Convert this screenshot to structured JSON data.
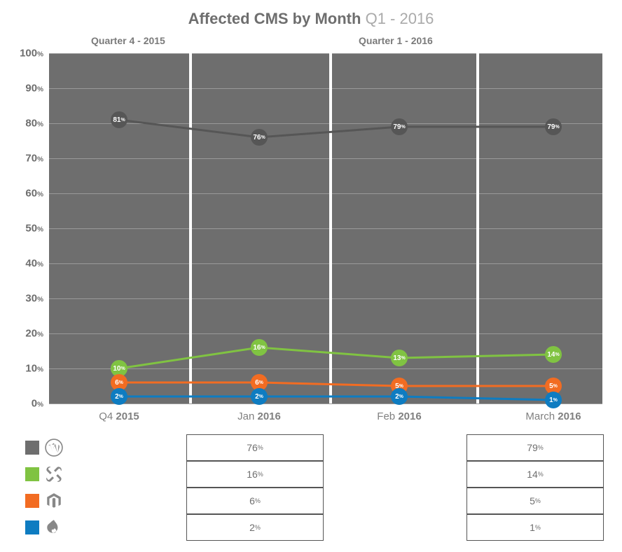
{
  "title": {
    "main": "Affected CMS by Month",
    "sub": "Q1 - 2016"
  },
  "sections": {
    "left": "Quarter 4 - 2015",
    "right": "Quarter 1 - 2016"
  },
  "xlabels": [
    {
      "a": "Q4 ",
      "b": "2015"
    },
    {
      "a": "Jan ",
      "b": "2016"
    },
    {
      "a": "Feb ",
      "b": "2016"
    },
    {
      "a": "March ",
      "b": "2016"
    }
  ],
  "yticks": [
    "0",
    "10",
    "20",
    "30",
    "40",
    "50",
    "60",
    "70",
    "80",
    "90",
    "100"
  ],
  "chart_data": {
    "type": "line",
    "ylim": [
      0,
      100
    ],
    "categories": [
      "Q4 2015",
      "Jan 2016",
      "Feb 2016",
      "March 2016"
    ],
    "series": [
      {
        "name": "WordPress",
        "color": "#565656",
        "values": [
          81,
          76,
          79,
          79
        ]
      },
      {
        "name": "Joomla",
        "color": "#80c342",
        "values": [
          10,
          16,
          13,
          14
        ]
      },
      {
        "name": "Magento",
        "color": "#f26c22",
        "values": [
          6,
          6,
          5,
          5
        ]
      },
      {
        "name": "Drupal",
        "color": "#0e7cc1",
        "values": [
          2,
          2,
          2,
          1
        ]
      }
    ]
  },
  "table": {
    "cols": [
      "Jan 2016",
      "March 2016"
    ],
    "rows": [
      {
        "name": "WordPress",
        "swatch": "#6e6e6e",
        "cells": [
          "76",
          "79"
        ]
      },
      {
        "name": "Joomla",
        "swatch": "#80c342",
        "cells": [
          "16",
          "14"
        ]
      },
      {
        "name": "Magento",
        "swatch": "#f26c22",
        "cells": [
          "6",
          "5"
        ]
      },
      {
        "name": "Drupal",
        "swatch": "#0e7cc1",
        "cells": [
          "2",
          "1"
        ]
      }
    ]
  },
  "pct": "%"
}
